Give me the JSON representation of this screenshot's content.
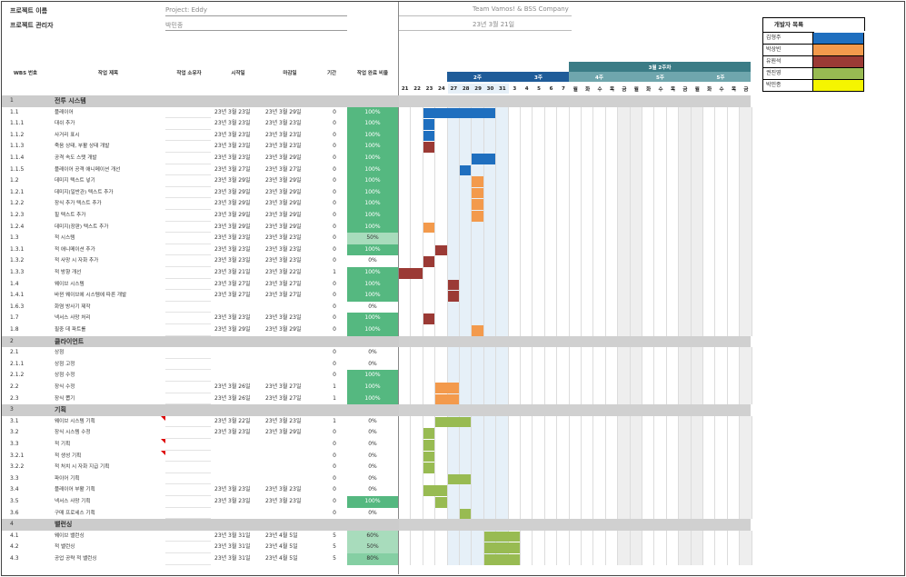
{
  "header": {
    "project_name_label": "프로젝트 이름",
    "project_name_value": "Project: Eddy",
    "project_manager_label": "프로젝트 관리자",
    "project_manager_value": "박민종",
    "team": "Team Vamos! & BSS Company",
    "date": "23년 3월 21일"
  },
  "legend": {
    "title": "개발자 목록",
    "members": [
      {
        "name": "김형주",
        "color": "#1f6fbf"
      },
      {
        "name": "박상빈",
        "color": "#f39a4c"
      },
      {
        "name": "유원석",
        "color": "#9b3a35"
      },
      {
        "name": "권진영",
        "color": "#98bb52"
      },
      {
        "name": "박민종",
        "color": "#f5f500"
      }
    ]
  },
  "columns": {
    "wbs": "WBS 번호",
    "title": "작업 제목",
    "owner": "작업 소유자",
    "start": "시작일",
    "end": "마감일",
    "duration": "기간",
    "progress": "작업 완료 비율"
  },
  "weeks": {
    "month_band": "3월 2주차",
    "w2": "2주",
    "w3": "3주",
    "w4a": "4주",
    "w5a": "5주",
    "w4b": "4주",
    "w5b": "5주"
  },
  "days": [
    "21",
    "22",
    "23",
    "24",
    "27",
    "28",
    "29",
    "30",
    "31",
    "3",
    "4",
    "5",
    "6",
    "7",
    "월",
    "화",
    "수",
    "목",
    "금",
    "월",
    "화",
    "수",
    "목",
    "금",
    "월",
    "화",
    "수",
    "목",
    "금"
  ],
  "rows": [
    {
      "wbs": "1",
      "title": "전투 시스템",
      "section": true
    },
    {
      "wbs": "1.1",
      "title": "플레이어",
      "start": "23년 3월 23일",
      "end": "23년 3월 29일",
      "dur": "0",
      "pct": "100%",
      "bars": [
        [
          2,
          6,
          "b"
        ]
      ]
    },
    {
      "wbs": "1.1.1",
      "title": "대쉬 추가",
      "start": "23년 3월 23일",
      "end": "23년 3월 23일",
      "dur": "0",
      "pct": "100%",
      "bars": [
        [
          2,
          1,
          "b"
        ]
      ]
    },
    {
      "wbs": "1.1.2",
      "title": "사거리 표시",
      "start": "23년 3월 23일",
      "end": "23년 3월 23일",
      "dur": "0",
      "pct": "100%",
      "bars": [
        [
          2,
          1,
          "b"
        ]
      ]
    },
    {
      "wbs": "1.1.3",
      "title": "죽음 상태, 부활 상태 개발",
      "start": "23년 3월 23일",
      "end": "23년 3월 23일",
      "dur": "0",
      "pct": "100%",
      "bars": [
        [
          2,
          1,
          "r"
        ]
      ]
    },
    {
      "wbs": "1.1.4",
      "title": "공격 속도 스탯 개발",
      "start": "23년 3월 23일",
      "end": "23년 3월 29일",
      "dur": "0",
      "pct": "100%",
      "bars": [
        [
          6,
          2,
          "b"
        ]
      ]
    },
    {
      "wbs": "1.1.5",
      "title": "플레이어 공격 애니메이션 개선",
      "start": "23년 3월 27일",
      "end": "23년 3월 27일",
      "dur": "0",
      "pct": "100%",
      "bars": [
        [
          5,
          1,
          "b"
        ]
      ]
    },
    {
      "wbs": "1.2",
      "title": "데미지 텍스트 넣기",
      "start": "23년 3월 29일",
      "end": "23년 3월 29일",
      "dur": "0",
      "pct": "100%",
      "bars": [
        [
          6,
          1,
          "o"
        ]
      ]
    },
    {
      "wbs": "1.2.1",
      "title": "데미지(일반관) 텍스트 추가",
      "start": "23년 3월 29일",
      "end": "23년 3월 29일",
      "dur": "0",
      "pct": "100%",
      "bars": [
        [
          6,
          1,
          "o"
        ]
      ]
    },
    {
      "wbs": "1.2.2",
      "title": "장식 추가 텍스트 추가",
      "start": "23년 3월 29일",
      "end": "23년 3월 29일",
      "dur": "0",
      "pct": "100%",
      "bars": [
        [
          6,
          1,
          "o"
        ]
      ]
    },
    {
      "wbs": "1.2.3",
      "title": "힐 텍스트 추가",
      "start": "23년 3월 29일",
      "end": "23년 3월 29일",
      "dur": "0",
      "pct": "100%",
      "bars": [
        [
          6,
          1,
          "o"
        ]
      ]
    },
    {
      "wbs": "1.2.4",
      "title": "데미지(장판) 텍스트 추가",
      "start": "23년 3월 29일",
      "end": "23년 3월 29일",
      "dur": "0",
      "pct": "100%",
      "bars": [
        [
          2,
          1,
          "o"
        ]
      ]
    },
    {
      "wbs": "1.3",
      "title": "적 시스템",
      "start": "23년 3월 23일",
      "end": "23년 3월 23일",
      "dur": "0",
      "pct": "50%",
      "bars": []
    },
    {
      "wbs": "1.3.1",
      "title": "적 애니메이션 추가",
      "start": "23년 3월 23일",
      "end": "23년 3월 23일",
      "dur": "0",
      "pct": "100%",
      "bars": [
        [
          3,
          1,
          "r"
        ]
      ]
    },
    {
      "wbs": "1.3.2",
      "title": "적 사망 시 자화 추가",
      "start": "23년 3월 23일",
      "end": "23년 3월 23일",
      "dur": "0",
      "pct": "0%",
      "bars": [
        [
          2,
          1,
          "r"
        ]
      ]
    },
    {
      "wbs": "1.3.3",
      "title": "적 방향 개선",
      "start": "23년 3월 21일",
      "end": "23년 3월 22일",
      "dur": "1",
      "pct": "100%",
      "bars": [
        [
          0,
          2,
          "r"
        ]
      ]
    },
    {
      "wbs": "1.4",
      "title": "웨이브 시스템",
      "start": "23년 3월 27일",
      "end": "23년 3월 27일",
      "dur": "0",
      "pct": "100%",
      "bars": [
        [
          4,
          1,
          "r"
        ]
      ]
    },
    {
      "wbs": "1.4.1",
      "title": "바뀐 웨이브에 시스템에 따른 개발",
      "start": "23년 3월 27일",
      "end": "23년 3월 27일",
      "dur": "0",
      "pct": "100%",
      "bars": [
        [
          4,
          1,
          "r"
        ]
      ]
    },
    {
      "wbs": "1.6.3",
      "title": "화염 방사기 제작",
      "start": "",
      "end": "",
      "dur": "0",
      "pct": "0%",
      "bars": []
    },
    {
      "wbs": "1.7",
      "title": "넥서스 사망 처리",
      "start": "23년 3월 23일",
      "end": "23년 3월 23일",
      "dur": "0",
      "pct": "100%",
      "bars": [
        [
          2,
          1,
          "r"
        ]
      ]
    },
    {
      "wbs": "1.8",
      "title": "필중 데 파트롤",
      "start": "23년 3월 29일",
      "end": "23년 3월 29일",
      "dur": "0",
      "pct": "100%",
      "bars": [
        [
          6,
          1,
          "o"
        ]
      ]
    },
    {
      "wbs": "2",
      "title": "클라이언트",
      "section": true
    },
    {
      "wbs": "2.1",
      "title": "상점",
      "start": "",
      "end": "",
      "dur": "0",
      "pct": "0%",
      "bars": []
    },
    {
      "wbs": "2.1.1",
      "title": "상점 고정",
      "start": "",
      "end": "",
      "dur": "0",
      "pct": "0%",
      "bars": []
    },
    {
      "wbs": "2.1.2",
      "title": "상점 수정",
      "start": "",
      "end": "",
      "dur": "0",
      "pct": "100%",
      "bars": []
    },
    {
      "wbs": "2.2",
      "title": "장식 수정",
      "start": "23년 3월 26일",
      "end": "23년 3월 27일",
      "dur": "1",
      "pct": "100%",
      "bars": [
        [
          3,
          2,
          "o"
        ]
      ]
    },
    {
      "wbs": "2.3",
      "title": "장식 뽑기",
      "start": "23년 3월 26일",
      "end": "23년 3월 27일",
      "dur": "1",
      "pct": "100%",
      "bars": [
        [
          3,
          2,
          "o"
        ]
      ]
    },
    {
      "wbs": "3",
      "title": "기획",
      "section": true
    },
    {
      "wbs": "3.1",
      "title": "웨이브 시스템 기획",
      "start": "23년 3월 22일",
      "end": "23년 3월 23일",
      "dur": "1",
      "pct": "0%",
      "bars": [
        [
          3,
          3,
          "g"
        ]
      ],
      "flag": true
    },
    {
      "wbs": "3.2",
      "title": "장식 시스템 수정",
      "start": "23년 3월 23일",
      "end": "23년 3월 29일",
      "dur": "0",
      "pct": "0%",
      "bars": [
        [
          2,
          1,
          "g"
        ]
      ]
    },
    {
      "wbs": "3.3",
      "title": "적 기획",
      "start": "",
      "end": "",
      "dur": "0",
      "pct": "0%",
      "bars": [
        [
          2,
          1,
          "g"
        ]
      ],
      "flag": true
    },
    {
      "wbs": "3.2.1",
      "title": "적 생성 기획",
      "start": "",
      "end": "",
      "dur": "0",
      "pct": "0%",
      "bars": [
        [
          2,
          1,
          "g"
        ]
      ],
      "flag": true
    },
    {
      "wbs": "3.2.2",
      "title": "적 처치 시 자화 지급 기획",
      "start": "",
      "end": "",
      "dur": "0",
      "pct": "0%",
      "bars": [
        [
          2,
          1,
          "g"
        ]
      ]
    },
    {
      "wbs": "3.3",
      "title": "파이어 기획",
      "start": "",
      "end": "",
      "dur": "0",
      "pct": "0%",
      "bars": [
        [
          4,
          2,
          "g"
        ]
      ]
    },
    {
      "wbs": "3.4",
      "title": "플레이어 부활 기획",
      "start": "23년 3월 23일",
      "end": "23년 3월 23일",
      "dur": "0",
      "pct": "0%",
      "bars": [
        [
          2,
          2,
          "g"
        ]
      ]
    },
    {
      "wbs": "3.5",
      "title": "넥서스 사망 기획",
      "start": "23년 3월 23일",
      "end": "23년 3월 23일",
      "dur": "0",
      "pct": "100%",
      "bars": [
        [
          3,
          1,
          "g"
        ]
      ]
    },
    {
      "wbs": "3.6",
      "title": "구매 프로세스 기획",
      "start": "",
      "end": "",
      "dur": "0",
      "pct": "0%",
      "bars": [
        [
          5,
          1,
          "g"
        ]
      ]
    },
    {
      "wbs": "4",
      "title": "밸런싱",
      "section": true
    },
    {
      "wbs": "4.1",
      "title": "웨이브 밸런싱",
      "start": "23년 3월 31일",
      "end": "23년 4월 5일",
      "dur": "5",
      "pct": "60%",
      "bars": [
        [
          7,
          3,
          "g"
        ]
      ]
    },
    {
      "wbs": "4.2",
      "title": "적 밸런싱",
      "start": "23년 3월 31일",
      "end": "23년 4월 5일",
      "dur": "5",
      "pct": "50%",
      "bars": [
        [
          7,
          3,
          "g"
        ]
      ]
    },
    {
      "wbs": "4.3",
      "title": "공업 공략 적 밸런싱",
      "start": "23년 3월 31일",
      "end": "23년 4월 5일",
      "dur": "5",
      "pct": "80%",
      "bars": [
        [
          7,
          3,
          "g"
        ]
      ]
    }
  ]
}
